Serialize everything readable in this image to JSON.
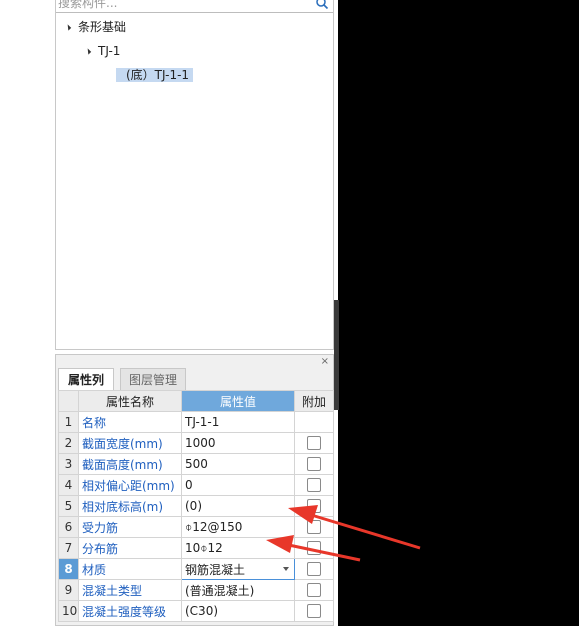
{
  "search": {
    "placeholder": "搜索构件..."
  },
  "tree": {
    "root": "条形基础",
    "child": "TJ-1",
    "leaf": "(底）TJ-1-1"
  },
  "panel": {
    "close": "×",
    "tabs": [
      "属性列表",
      "图层管理"
    ]
  },
  "table": {
    "headers": [
      "属性名称",
      "属性值",
      "附加"
    ],
    "rows": [
      {
        "num": "1",
        "name": "名称",
        "value": "TJ-1-1",
        "checkbox": false
      },
      {
        "num": "2",
        "name": "截面宽度(mm)",
        "value": "1000",
        "checkbox": true
      },
      {
        "num": "3",
        "name": "截面高度(mm)",
        "value": "500",
        "checkbox": true
      },
      {
        "num": "4",
        "name": "相对偏心距(mm)",
        "value": "0",
        "checkbox": true
      },
      {
        "num": "5",
        "name": "相对底标高(m)",
        "value": "(0)",
        "checkbox": true
      },
      {
        "num": "6",
        "name": "受力筋",
        "value": "⌽12@150",
        "checkbox": true
      },
      {
        "num": "7",
        "name": "分布筋",
        "value": "10⌽12",
        "checkbox": true
      },
      {
        "num": "8",
        "name": "材质",
        "value": "钢筋混凝土",
        "checkbox": true
      },
      {
        "num": "9",
        "name": "混凝土类型",
        "value": "(普通混凝土)",
        "checkbox": true
      },
      {
        "num": "10",
        "name": "混凝土强度等级",
        "value": "(C30)",
        "checkbox": true
      }
    ]
  },
  "colors": {
    "accent": "#5b9bd5",
    "annotation_arrow": "#e8372a"
  }
}
